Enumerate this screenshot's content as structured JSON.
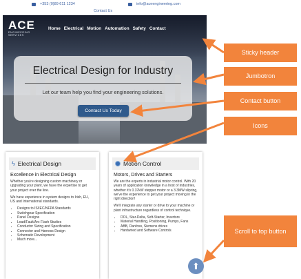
{
  "topbar": {
    "phone": "+353 (0)89 611 1234",
    "email": "info@aceengineering.com",
    "contact_link": "Contact Us"
  },
  "header": {
    "logo_main": "ACE",
    "logo_sub": "ENGINEERING SERVICES",
    "nav": [
      "Home",
      "Electrical",
      "Motion",
      "Automation",
      "Safety",
      "Contact"
    ]
  },
  "jumbotron": {
    "title": "Electrical Design for Industry",
    "subtitle": "Let our team help you find your engineering solutions.",
    "cta": "Contact Us Today"
  },
  "cards": [
    {
      "heading": "Electrical Design",
      "subheading": "Excellence in Electrical Design",
      "para1": "Whether you're designing custom machinery or upgrading your plant, we have the expertise to get your project over the line.",
      "para2": "We have experience in system designs to Irish, EU, US and International standards.",
      "items": [
        "Designs to IS/IEC/NFPA Standards",
        "Switchgear Specification",
        "Panel Designs",
        "Load/Fault/Arc Flash Studies",
        "Conductor Sizing and Specification",
        "Connector and Harness Design",
        "Schematic Development",
        "Much more..."
      ]
    },
    {
      "heading": "Motion Control",
      "subheading": "Motors, Drives and Starters",
      "para1": "We are the experts in industrial motor control. With 20 years of application knowledge in a host of industries, whether it's 0.37kW stepper motor or a 3.3MW slipring, we've the experience to get your project moving in the right direction!",
      "para2": "We'll integrate any starter or drive to your machine or plant infrastructure regardless of control technique.",
      "items": [
        "DOL, Star-Delta, Soft-Starter, Invertors",
        "Material Handling, Positioning, Pumps, Fans",
        "ABB, Danfoss, Siemens drives",
        "Hardwired and Software Controls"
      ]
    }
  ],
  "annotations": {
    "sticky_header": "Sticky header",
    "jumbotron": "Jumbotron",
    "contact_button": "Contact button",
    "icons": "Icons",
    "scroll_to_top": "Scroll to top button"
  },
  "colors": {
    "accent": "#2f5a8c",
    "callout": "#f2843c",
    "icon_blue": "#3a6fb5"
  },
  "icons": {
    "phone": "phone-icon",
    "email": "envelope-icon",
    "electrical": "lightning-bolt-icon",
    "motion": "gear-icon",
    "scroll": "arrow-up-icon"
  }
}
